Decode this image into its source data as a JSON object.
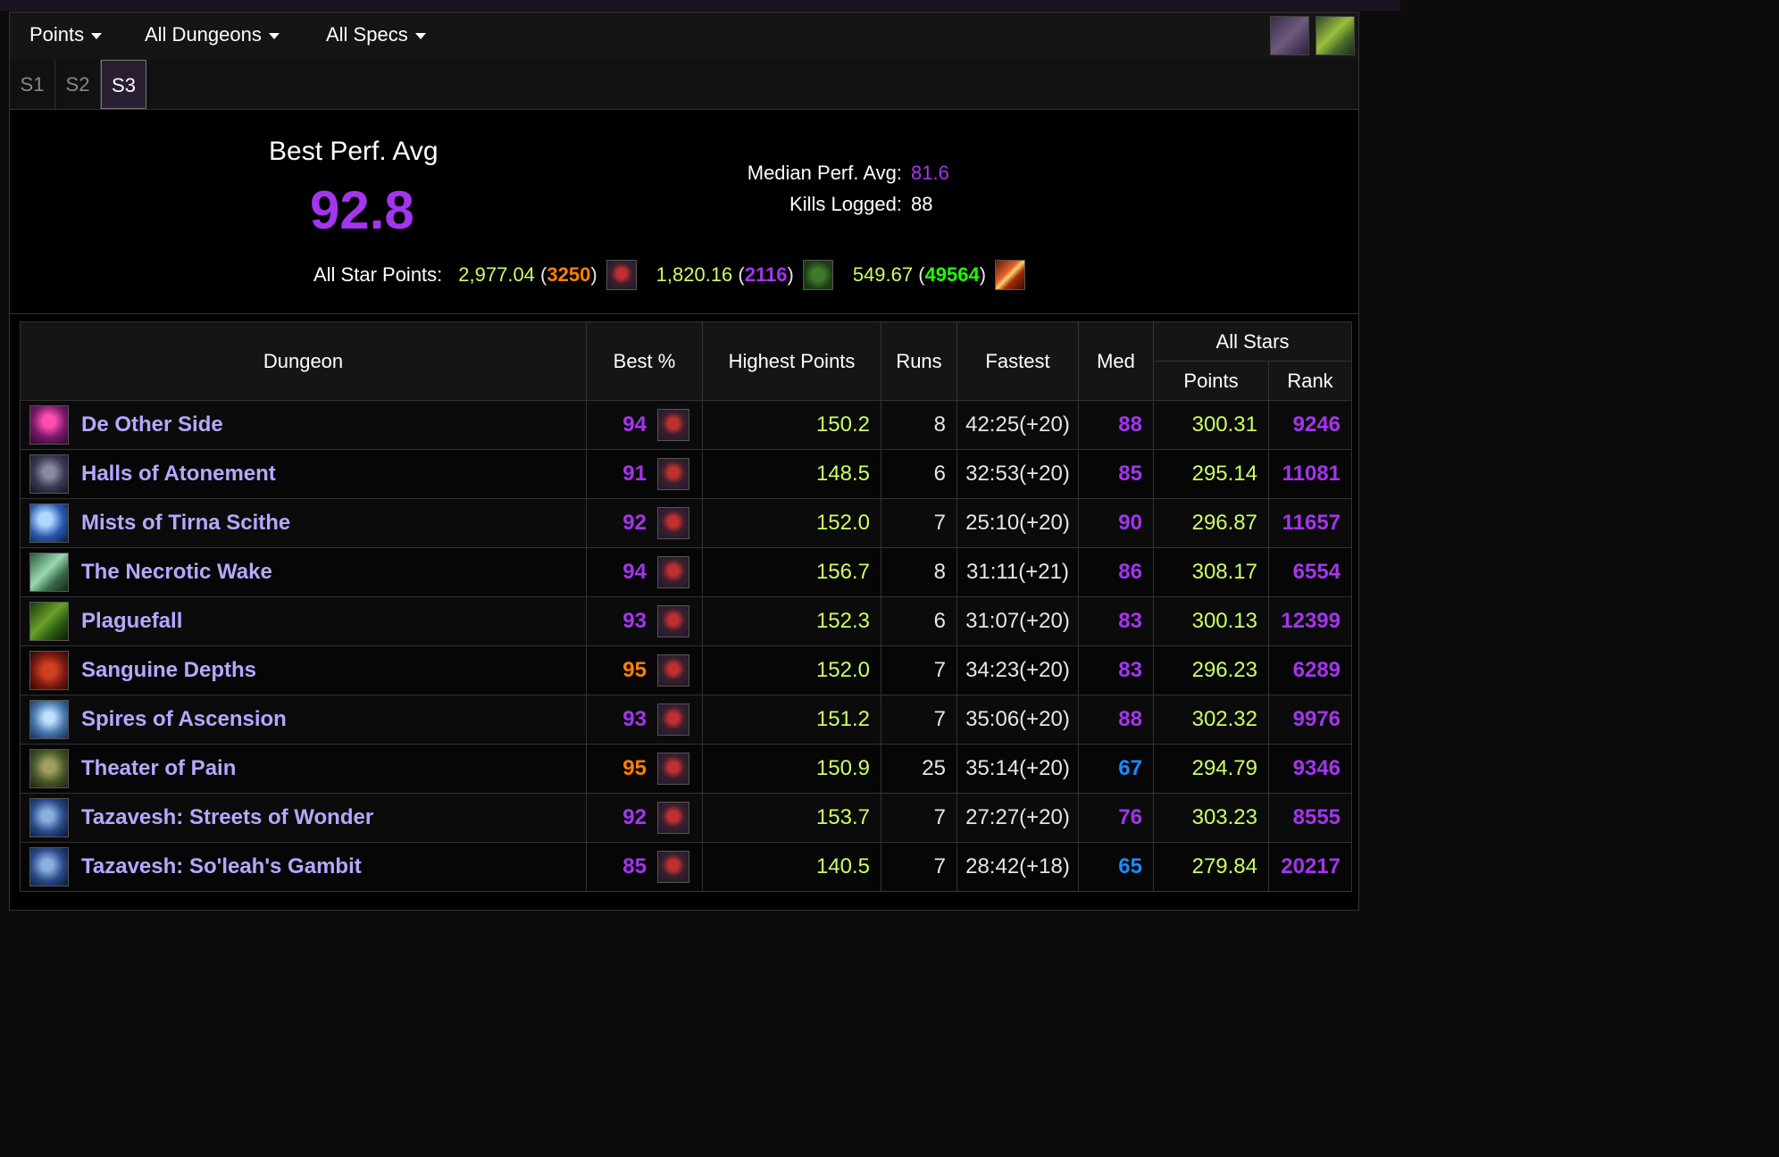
{
  "toolbar": {
    "dropdowns": [
      "Points",
      "All Dungeons",
      "All Specs"
    ],
    "icons": [
      "character-gear-icon",
      "mythic-key-icon"
    ]
  },
  "season_tabs": {
    "items": [
      "S1",
      "S2",
      "S3"
    ],
    "active": "S3"
  },
  "summary": {
    "best_perf_label": "Best Perf. Avg",
    "best_perf_value": "92.8",
    "median_label": "Median Perf. Avg:",
    "median_value": "81.6",
    "kills_label": "Kills Logged:",
    "kills_value": "88",
    "all_star_label": "All Star Points:",
    "all_star": [
      {
        "points": "2,977.04",
        "rank": "3250",
        "rank_color": "#ff8000",
        "icon": "demon-hunter-spec-icon"
      },
      {
        "points": "1,820.16",
        "rank": "2116",
        "rank_color": "#a335ee",
        "icon": "green-class-icon"
      },
      {
        "points": "549.67",
        "rank": "49564",
        "rank_color": "#1eff00",
        "icon": "fire-slash-icon"
      }
    ]
  },
  "table": {
    "headers": {
      "dungeon": "Dungeon",
      "best": "Best %",
      "highest": "Highest Points",
      "runs": "Runs",
      "fastest": "Fastest",
      "med": "Med",
      "allstars": "All Stars",
      "points": "Points",
      "rank": "Rank"
    },
    "rows": [
      {
        "name": "De Other Side",
        "best": "94",
        "best_q": "mythic",
        "highest": "150.2",
        "runs": "8",
        "fastest": "42:25(+20)",
        "med": "88",
        "med_q": "mythic",
        "points": "300.31",
        "rank": "9246",
        "icon": "de-other-side-icon"
      },
      {
        "name": "Halls of Atonement",
        "best": "91",
        "best_q": "mythic",
        "highest": "148.5",
        "runs": "6",
        "fastest": "32:53(+20)",
        "med": "85",
        "med_q": "mythic",
        "points": "295.14",
        "rank": "11081",
        "icon": "halls-of-atonement-icon"
      },
      {
        "name": "Mists of Tirna Scithe",
        "best": "92",
        "best_q": "mythic",
        "highest": "152.0",
        "runs": "7",
        "fastest": "25:10(+20)",
        "med": "90",
        "med_q": "mythic",
        "points": "296.87",
        "rank": "11657",
        "icon": "mists-of-tirna-scithe-icon"
      },
      {
        "name": "The Necrotic Wake",
        "best": "94",
        "best_q": "mythic",
        "highest": "156.7",
        "runs": "8",
        "fastest": "31:11(+21)",
        "med": "86",
        "med_q": "mythic",
        "points": "308.17",
        "rank": "6554",
        "icon": "necrotic-wake-icon"
      },
      {
        "name": "Plaguefall",
        "best": "93",
        "best_q": "mythic",
        "highest": "152.3",
        "runs": "6",
        "fastest": "31:07(+20)",
        "med": "83",
        "med_q": "mythic",
        "points": "300.13",
        "rank": "12399",
        "icon": "plaguefall-icon"
      },
      {
        "name": "Sanguine Depths",
        "best": "95",
        "best_q": "legend",
        "highest": "152.0",
        "runs": "7",
        "fastest": "34:23(+20)",
        "med": "83",
        "med_q": "mythic",
        "points": "296.23",
        "rank": "6289",
        "icon": "sanguine-depths-icon"
      },
      {
        "name": "Spires of Ascension",
        "best": "93",
        "best_q": "mythic",
        "highest": "151.2",
        "runs": "7",
        "fastest": "35:06(+20)",
        "med": "88",
        "med_q": "mythic",
        "points": "302.32",
        "rank": "9976",
        "icon": "spires-of-ascension-icon"
      },
      {
        "name": "Theater of Pain",
        "best": "95",
        "best_q": "legend",
        "highest": "150.9",
        "runs": "25",
        "fastest": "35:14(+20)",
        "med": "67",
        "med_q": "rare",
        "points": "294.79",
        "rank": "9346",
        "icon": "theater-of-pain-icon"
      },
      {
        "name": "Tazavesh: Streets of Wonder",
        "best": "92",
        "best_q": "mythic",
        "highest": "153.7",
        "runs": "7",
        "fastest": "27:27(+20)",
        "med": "76",
        "med_q": "mythic",
        "points": "303.23",
        "rank": "8555",
        "icon": "tazavesh-icon"
      },
      {
        "name": "Tazavesh: So'leah's Gambit",
        "best": "85",
        "best_q": "mythic",
        "highest": "140.5",
        "runs": "7",
        "fastest": "28:42(+18)",
        "med": "65",
        "med_q": "rare",
        "points": "279.84",
        "rank": "20217",
        "icon": "tazavesh-icon"
      }
    ]
  },
  "colors": {
    "mythic": "#a335ee",
    "legendary": "#ff8000",
    "rare": "#1a8cff",
    "points": "#ccff66",
    "dungeon_name": "#b7a7ff"
  }
}
